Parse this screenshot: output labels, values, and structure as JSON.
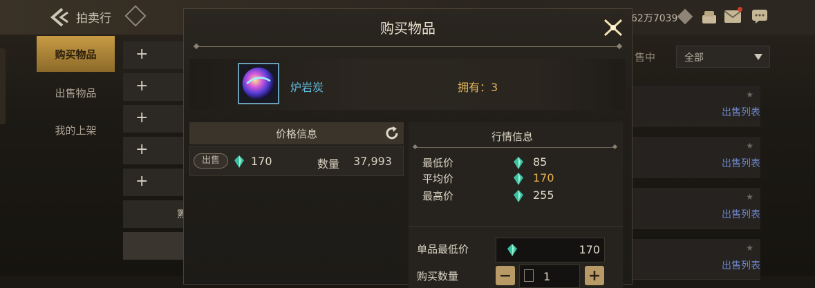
{
  "background": {
    "title": "拍卖行",
    "currency_text": "62万7039",
    "side_tabs": [
      {
        "label": "购买物品",
        "active": true
      },
      {
        "label": "出售物品",
        "active": false
      },
      {
        "label": "我的上架",
        "active": false
      }
    ],
    "category_rows": [
      {
        "icon": "plus-icon",
        "text": ""
      },
      {
        "icon": "plus-icon",
        "text": ""
      },
      {
        "icon": "plus-icon",
        "text": ""
      },
      {
        "icon": "plus-icon",
        "text": ""
      },
      {
        "icon": "plus-icon",
        "text": ""
      },
      {
        "icon": "",
        "text": "罴"
      }
    ],
    "status_text": "售中",
    "filter_dropdown": "全部",
    "list_link_label": "出售列表"
  },
  "modal": {
    "title": "购买物品",
    "item": {
      "name": "炉岩炭",
      "owned_label": "拥有：3"
    },
    "price_info": {
      "header": "价格信息",
      "rows": [
        {
          "badge": "出售",
          "price": "170",
          "qty_label": "数量",
          "qty": "37,993"
        }
      ]
    },
    "market_info": {
      "header": "行情信息",
      "stats": [
        {
          "label": "最低价",
          "value": "85"
        },
        {
          "label": "平均价",
          "value": "170"
        },
        {
          "label": "最高价",
          "value": "255"
        }
      ]
    },
    "purchase": {
      "unit_price_label": "单品最低价",
      "unit_price": "170",
      "qty_label": "购买数量",
      "qty_value": "1"
    }
  },
  "colors": {
    "gold": "#e2b659",
    "item_blue": "#5fb6d6",
    "gem_teal": "#3cc2a3",
    "link_blue": "#6e86c8"
  }
}
